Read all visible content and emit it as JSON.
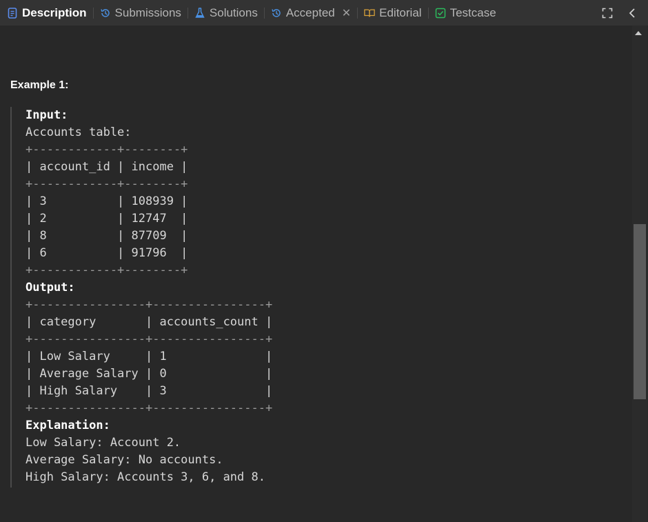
{
  "tabs": [
    {
      "label": "Description",
      "icon": "document-icon"
    },
    {
      "label": "Submissions",
      "icon": "history-icon"
    },
    {
      "label": "Solutions",
      "icon": "flask-icon"
    },
    {
      "label": "Accepted",
      "icon": "history-icon"
    },
    {
      "label": "Editorial",
      "icon": "book-icon"
    },
    {
      "label": "Testcase",
      "icon": "check-box-icon"
    }
  ],
  "toolbar": {
    "expand_icon": "expand-icon",
    "collapse_icon": "chevron-left-icon"
  },
  "content": {
    "example_title": "Example 1:",
    "lines": [
      {
        "text": "Input:",
        "bold": true
      },
      {
        "text": "Accounts table:"
      },
      {
        "text": "+------------+--------+",
        "border": true
      },
      {
        "text": "| account_id | income |"
      },
      {
        "text": "+------------+--------+",
        "border": true
      },
      {
        "text": "| 3          | 108939 |"
      },
      {
        "text": "| 2          | 12747  |"
      },
      {
        "text": "| 8          | 87709  |"
      },
      {
        "text": "| 6          | 91796  |"
      },
      {
        "text": "+------------+--------+",
        "border": true
      },
      {
        "text": "Output:",
        "bold": true
      },
      {
        "text": "+----------------+----------------+",
        "border": true
      },
      {
        "text": "| category       | accounts_count |"
      },
      {
        "text": "+----------------+----------------+",
        "border": true
      },
      {
        "text": "| Low Salary     | 1              |"
      },
      {
        "text": "| Average Salary | 0              |"
      },
      {
        "text": "| High Salary    | 3              |"
      },
      {
        "text": "+----------------+----------------+",
        "border": true
      },
      {
        "text": "Explanation:",
        "bold": true
      },
      {
        "text": "Low Salary: Account 2."
      },
      {
        "text": "Average Salary: No accounts."
      },
      {
        "text": "High Salary: Accounts 3, 6, and 8."
      }
    ]
  },
  "colors": {
    "background": "#282828",
    "tabbar": "#333333",
    "description_icon": "#5b8def",
    "flask_icon": "#4a90e2",
    "book_icon": "#d9a23a",
    "check_icon": "#2cbb5d"
  }
}
